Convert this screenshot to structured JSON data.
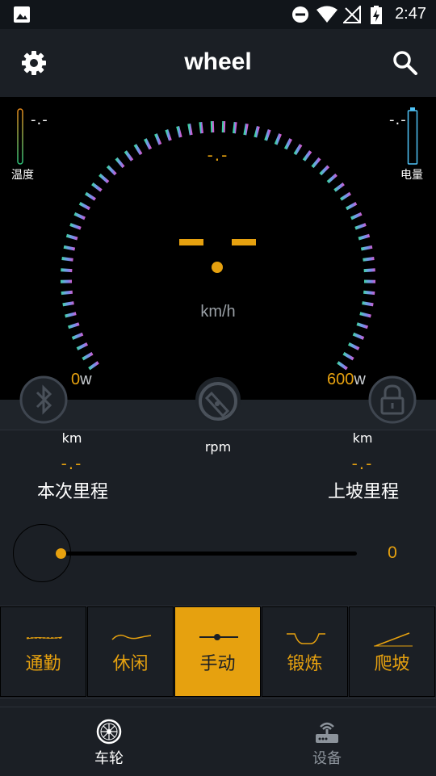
{
  "status_bar": {
    "time": "2:47"
  },
  "app_bar": {
    "title": "wheel"
  },
  "gauge": {
    "temperature_value": "-.-",
    "temperature_label": "温度",
    "battery_value": "-.-",
    "battery_label": "电量",
    "speed_small": "-.-",
    "speed_big": "--",
    "speed_unit": "km/h",
    "power_min": "0",
    "power_max": "600",
    "power_unit": "w"
  },
  "stats": {
    "trip": {
      "unit": "km",
      "value": "-.-",
      "label": "本次里程"
    },
    "cadence": {
      "unit": "rpm"
    },
    "climb": {
      "unit": "km",
      "value": "-.-",
      "label": "上坡里程"
    }
  },
  "assist_slider": {
    "value": "0"
  },
  "modes": [
    {
      "label": "通勤",
      "icon": "commute-wave-icon",
      "active": false
    },
    {
      "label": "休闲",
      "icon": "leisure-wave-icon",
      "active": false
    },
    {
      "label": "手动",
      "icon": "manual-slider-icon",
      "active": true
    },
    {
      "label": "锻炼",
      "icon": "workout-curve-icon",
      "active": false
    },
    {
      "label": "爬坡",
      "icon": "climb-slope-icon",
      "active": false
    }
  ],
  "bottom_nav": [
    {
      "label": "车轮",
      "icon": "wheel-icon",
      "active": true
    },
    {
      "label": "设备",
      "icon": "router-icon",
      "active": false
    }
  ],
  "colors": {
    "accent": "#e6a10f",
    "background": "#1b1f25",
    "gauge_bg": "#000000"
  }
}
